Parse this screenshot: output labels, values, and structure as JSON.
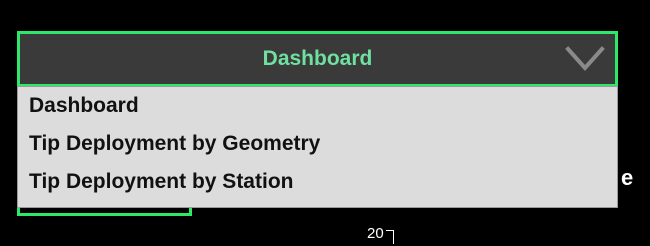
{
  "select": {
    "selected_value": "Dashboard",
    "chevron_icon": "chevron-down-icon",
    "accent_color": "#2ee86a",
    "header_bg": "#3a3a3a"
  },
  "options": [
    {
      "label": "Dashboard"
    },
    {
      "label": "Tip Deployment by Geometry"
    },
    {
      "label": "Tip Deployment by Station"
    }
  ],
  "background": {
    "title_fragment": "e",
    "axis_tick_label": "20"
  }
}
